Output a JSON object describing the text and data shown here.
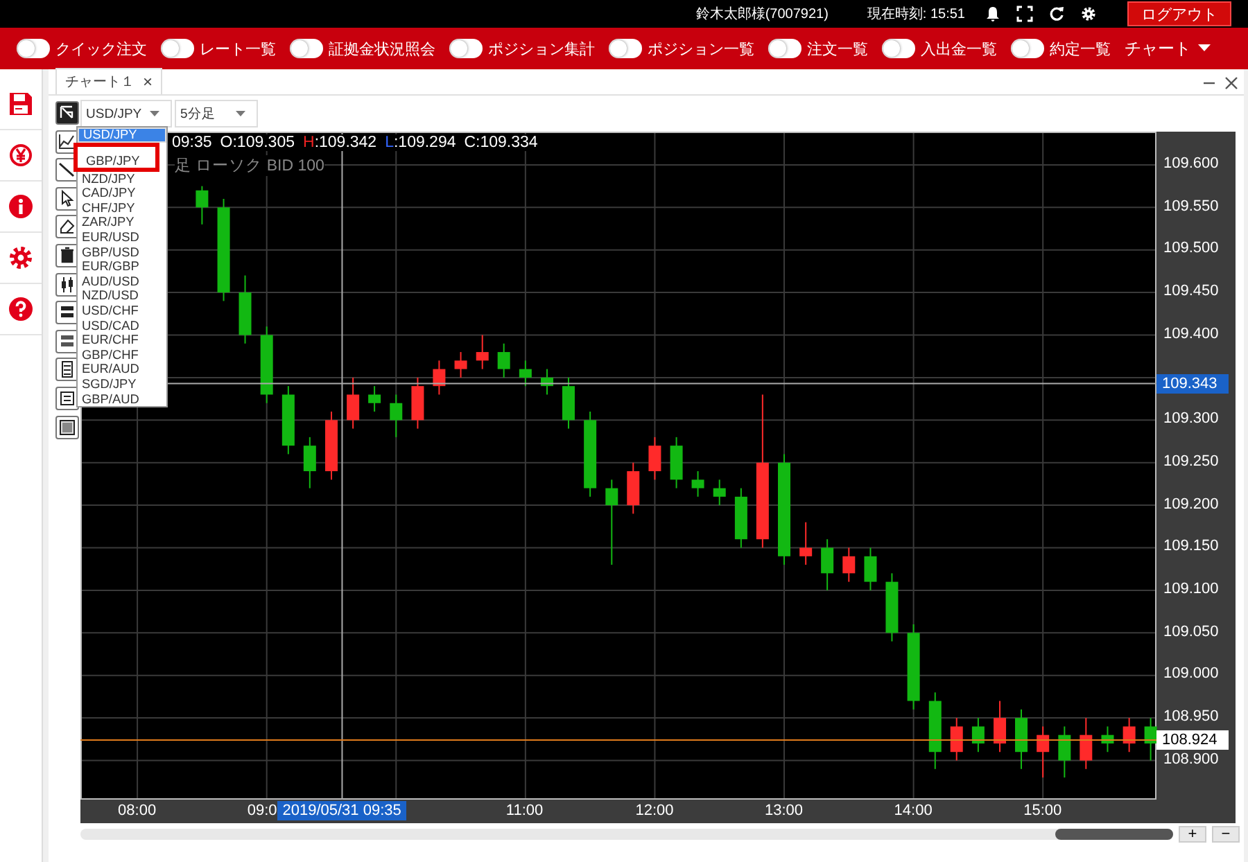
{
  "header": {
    "user": "鈴木太郎様(7007921)",
    "clock": "現在時刻: 15:51",
    "logout": "ログアウト"
  },
  "nav": [
    {
      "kind": "toggle",
      "label": "クイック注文",
      "on": false
    },
    {
      "kind": "toggle",
      "label": "レート一覧",
      "on": false
    },
    {
      "kind": "toggle",
      "label": "証拠金状況照会",
      "on": false
    },
    {
      "kind": "toggle",
      "label": "ポジション集計",
      "on": false
    },
    {
      "kind": "toggle",
      "label": "ポジション一覧",
      "on": false
    },
    {
      "kind": "toggle",
      "label": "注文一覧",
      "on": false
    },
    {
      "kind": "toggle",
      "label": "入出金一覧",
      "on": false
    },
    {
      "kind": "toggle",
      "label": "約定一覧",
      "on": false
    },
    {
      "kind": "menu",
      "label": "チャート"
    }
  ],
  "tab": {
    "label": "チャート１",
    "close": "×",
    "selected": true
  },
  "symbol_select": {
    "value": "USD/JPY"
  },
  "period_select": {
    "value": "5分足"
  },
  "symbol_list": [
    {
      "label": "USD/JPY",
      "selected": true,
      "highlighted": false
    },
    {
      "label": "GBP/JPY",
      "selected": false,
      "highlighted": true
    },
    {
      "label": "NZD/JPY",
      "selected": false,
      "highlighted": false
    },
    {
      "label": "CAD/JPY",
      "selected": false,
      "highlighted": false
    },
    {
      "label": "CHF/JPY",
      "selected": false,
      "highlighted": false
    },
    {
      "label": "ZAR/JPY",
      "selected": false,
      "highlighted": false
    },
    {
      "label": "EUR/USD",
      "selected": false,
      "highlighted": false
    },
    {
      "label": "GBP/USD",
      "selected": false,
      "highlighted": false
    },
    {
      "label": "EUR/GBP",
      "selected": false,
      "highlighted": false
    },
    {
      "label": "AUD/USD",
      "selected": false,
      "highlighted": false
    },
    {
      "label": "NZD/USD",
      "selected": false,
      "highlighted": false
    },
    {
      "label": "USD/CHF",
      "selected": false,
      "highlighted": false
    },
    {
      "label": "USD/CAD",
      "selected": false,
      "highlighted": false
    },
    {
      "label": "EUR/CHF",
      "selected": false,
      "highlighted": false
    },
    {
      "label": "GBP/CHF",
      "selected": false,
      "highlighted": false
    },
    {
      "label": "EUR/AUD",
      "selected": false,
      "highlighted": false
    },
    {
      "label": "SGD/JPY",
      "selected": false,
      "highlighted": false
    },
    {
      "label": "GBP/AUD",
      "selected": false,
      "highlighted": false
    }
  ],
  "ohlc": {
    "time": "09:35",
    "open": "O:109.305",
    "high_key": "H",
    "high": ":109.342",
    "low_key": "L",
    "low": ":109.294",
    "close": "C:109.334"
  },
  "chart_caption": "足 ローソク BID 100",
  "chart_data": {
    "type": "candlestick",
    "x": [
      8.5,
      8.667,
      8.833,
      9,
      9.167,
      9.333,
      9.5,
      9.667,
      9.833,
      10,
      10.167,
      10.333,
      10.5,
      10.667,
      10.833,
      11,
      11.167,
      11.333,
      11.5,
      11.667,
      11.833,
      12,
      12.167,
      12.333,
      12.5,
      12.667,
      12.833,
      13,
      13.167,
      13.333,
      13.5,
      13.667,
      13.833,
      14,
      14.167,
      14.333,
      14.5,
      14.667,
      14.833,
      15,
      15.167,
      15.333,
      15.5,
      15.667,
      15.833
    ],
    "grid": true,
    "xlim": [
      7.56,
      15.878
    ],
    "ylim": [
      108.854,
      109.639
    ],
    "series": [
      {
        "ohlc": [
          [
            109.57,
            109.575,
            109.53,
            109.55
          ],
          [
            109.55,
            109.56,
            109.44,
            109.45
          ],
          [
            109.45,
            109.47,
            109.39,
            109.4
          ],
          [
            109.4,
            109.41,
            109.32,
            109.33
          ],
          [
            109.33,
            109.34,
            109.26,
            109.27
          ],
          [
            109.27,
            109.28,
            109.22,
            109.24
          ],
          [
            109.24,
            109.31,
            109.23,
            109.3
          ],
          [
            109.3,
            109.35,
            109.29,
            109.33
          ],
          [
            109.33,
            109.34,
            109.31,
            109.32
          ],
          [
            109.32,
            109.33,
            109.28,
            109.3
          ],
          [
            109.3,
            109.35,
            109.29,
            109.34
          ],
          [
            109.34,
            109.37,
            109.33,
            109.36
          ],
          [
            109.36,
            109.38,
            109.35,
            109.37
          ],
          [
            109.37,
            109.4,
            109.36,
            109.38
          ],
          [
            109.38,
            109.39,
            109.35,
            109.36
          ],
          [
            109.36,
            109.37,
            109.34,
            109.35
          ],
          [
            109.35,
            109.36,
            109.33,
            109.34
          ],
          [
            109.34,
            109.35,
            109.29,
            109.3
          ],
          [
            109.3,
            109.31,
            109.21,
            109.22
          ],
          [
            109.22,
            109.23,
            109.13,
            109.2
          ],
          [
            109.2,
            109.25,
            109.19,
            109.24
          ],
          [
            109.24,
            109.28,
            109.23,
            109.27
          ],
          [
            109.27,
            109.28,
            109.22,
            109.23
          ],
          [
            109.23,
            109.24,
            109.21,
            109.22
          ],
          [
            109.22,
            109.23,
            109.2,
            109.21
          ],
          [
            109.21,
            109.22,
            109.15,
            109.16
          ],
          [
            109.16,
            109.33,
            109.15,
            109.25
          ],
          [
            109.25,
            109.26,
            109.13,
            109.14
          ],
          [
            109.14,
            109.18,
            109.13,
            109.15
          ],
          [
            109.15,
            109.16,
            109.1,
            109.12
          ],
          [
            109.12,
            109.15,
            109.11,
            109.14
          ],
          [
            109.14,
            109.15,
            109.1,
            109.11
          ],
          [
            109.11,
            109.12,
            109.04,
            109.05
          ],
          [
            109.05,
            109.06,
            108.96,
            108.97
          ],
          [
            108.97,
            108.98,
            108.89,
            108.91
          ],
          [
            108.91,
            108.95,
            108.9,
            108.94
          ],
          [
            108.94,
            108.95,
            108.91,
            108.92
          ],
          [
            108.92,
            108.97,
            108.91,
            108.95
          ],
          [
            108.95,
            108.96,
            108.89,
            108.91
          ],
          [
            108.91,
            108.94,
            108.88,
            108.93
          ],
          [
            108.93,
            108.94,
            108.88,
            108.9
          ],
          [
            108.9,
            108.95,
            108.89,
            108.93
          ],
          [
            108.93,
            108.94,
            108.91,
            108.92
          ],
          [
            108.92,
            108.95,
            108.91,
            108.94
          ],
          [
            108.94,
            108.95,
            108.9,
            108.92
          ]
        ]
      }
    ],
    "xticks": [
      {
        "value": 8,
        "label": "08:00"
      },
      {
        "value": 9,
        "label": "09:0"
      },
      {
        "value": 11,
        "label": "11:00"
      },
      {
        "value": 12,
        "label": "12:00"
      },
      {
        "value": 13,
        "label": "13:00"
      },
      {
        "value": 14,
        "label": "14:00"
      },
      {
        "value": 15,
        "label": "15:00"
      }
    ],
    "yticks": [
      {
        "value": 109.6,
        "label": "109.600"
      },
      {
        "value": 109.55,
        "label": "109.550"
      },
      {
        "value": 109.5,
        "label": "109.500"
      },
      {
        "value": 109.45,
        "label": "109.450"
      },
      {
        "value": 109.4,
        "label": "109.400"
      },
      {
        "value": 109.3,
        "label": "109.300"
      },
      {
        "value": 109.25,
        "label": "109.250"
      },
      {
        "value": 109.2,
        "label": "109.200"
      },
      {
        "value": 109.15,
        "label": "109.150"
      },
      {
        "value": 109.1,
        "label": "109.100"
      },
      {
        "value": 109.05,
        "label": "109.050"
      },
      {
        "value": 109.0,
        "label": "109.000"
      },
      {
        "value": 108.95,
        "label": "108.950"
      },
      {
        "value": 108.9,
        "label": "108.900"
      }
    ],
    "ref_lines": [
      {
        "axis": "x",
        "value": 9.583,
        "color": "#aaaaaa"
      },
      {
        "axis": "y",
        "value": 109.343,
        "label": "109.343",
        "color": "#aaaaaa"
      },
      {
        "axis": "y",
        "value": 108.924,
        "label": "108.924",
        "color": "#e07b1c"
      }
    ]
  },
  "crosshair_time": "2019/05/31 09:35",
  "zoom_buttons": [
    "+",
    "−"
  ]
}
